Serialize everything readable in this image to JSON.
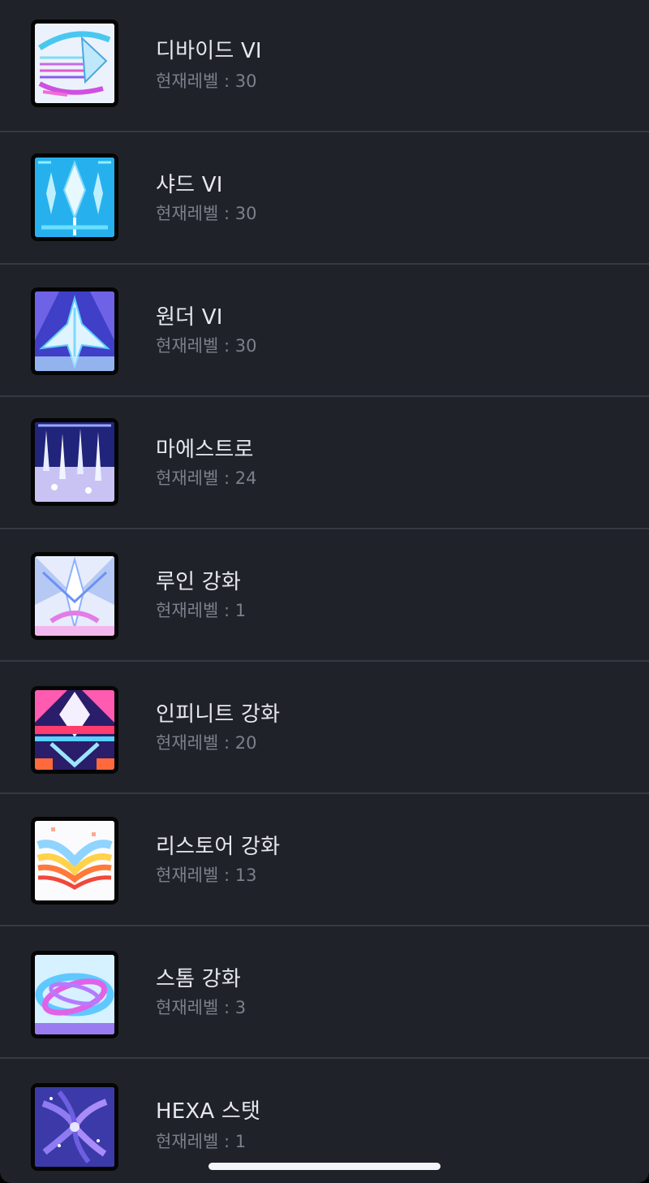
{
  "items": [
    {
      "name": "디바이드 VI",
      "level_label": "현재레벨 : ",
      "level": "30",
      "icon": "divide-skill-icon"
    },
    {
      "name": "샤드 VI",
      "level_label": "현재레벨 : ",
      "level": "30",
      "icon": "shard-skill-icon"
    },
    {
      "name": "원더 VI",
      "level_label": "현재레벨 : ",
      "level": "30",
      "icon": "wonder-skill-icon"
    },
    {
      "name": "마에스트로",
      "level_label": "현재레벨 : ",
      "level": "24",
      "icon": "maestro-skill-icon"
    },
    {
      "name": "루인 강화",
      "level_label": "현재레벨 : ",
      "level": "1",
      "icon": "ruin-skill-icon"
    },
    {
      "name": "인피니트 강화",
      "level_label": "현재레벨 : ",
      "level": "20",
      "icon": "infinite-skill-icon"
    },
    {
      "name": "리스토어 강화",
      "level_label": "현재레벨 : ",
      "level": "13",
      "icon": "restore-skill-icon"
    },
    {
      "name": "스톰 강화",
      "level_label": "현재레벨 : ",
      "level": "3",
      "icon": "storm-skill-icon"
    },
    {
      "name": "HEXA 스탯",
      "level_label": "현재레벨 : ",
      "level": "1",
      "icon": "hexa-stat-icon"
    }
  ],
  "colors": {
    "background": "#1f2229",
    "divider": "#353941",
    "name_text": "#e6e8ee",
    "level_text": "#7c808a"
  }
}
